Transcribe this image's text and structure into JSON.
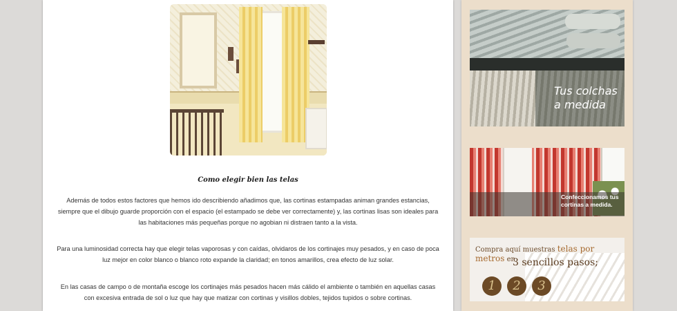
{
  "article": {
    "heading": "Como elegir bien las telas",
    "paragraphs": [
      "Además de todos estos factores que hemos ido describiendo añadimos que, las cortinas estampadas animan grandes estancias, siempre que el dibujo guarde proporción con el espacio (el estampado se debe ver correctamente) y, las cortinas lisas son ideales para las habitaciones más pequeñas porque no agobian ni distraen tanto a la vista.",
      "Para una luminosidad correcta hay que elegir telas vaporosas y con caídas, olvidaros de los cortinajes muy pesados, y en caso de poca luz mejor en color blanco o blanco roto expande la claridad; en tonos amarillos, crea efecto de luz solar.",
      "En las casas de campo o de montaña escoge los cortinajes más pesados hacen más cálido el ambiente o también en aquellas casas con excesiva entrada de sol o luz que hay que matizar con cortinas y visillos dobles, tejidos tupidos o sobre cortinas."
    ]
  },
  "sidebar": {
    "banner_colchas": {
      "line1": "Tus colchas",
      "line2": "a medida"
    },
    "banner_cortinas": {
      "line1": "Confeccionamos tus",
      "line2": "cortinas a medida."
    },
    "banner_muestras": {
      "prefix": "Compra aquí muestras ",
      "highlight": "telas por metros",
      "suffix": " en",
      "line2": "3 sencillos pasos;",
      "steps": [
        "1",
        "2",
        "3"
      ]
    }
  }
}
